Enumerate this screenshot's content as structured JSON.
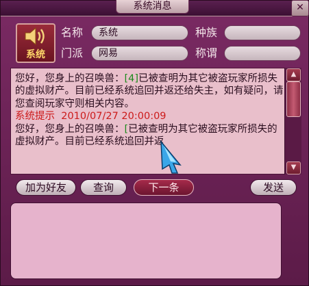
{
  "window": {
    "title": "系统消息",
    "close_icon": "close-icon"
  },
  "sender": {
    "icon": "speaker-icon",
    "label": "系统",
    "name_label": "名称",
    "name_value": "系统",
    "race_label": "种族",
    "race_value": "",
    "faction_label": "门派",
    "faction_value": "网易",
    "title_label": "称谓",
    "title_value": ""
  },
  "messages": [
    {
      "body_prefix": "您好，您身上的召唤兽：",
      "tag": "[4]",
      "body_suffix": "已被查明为其它被盗玩家所损失的虚拟财产。目前已经系统追回并返还给失主，如有疑问，请您查阅玩家守则相关内容。"
    },
    {
      "header_prefix": "系统提示",
      "timestamp": "2010/07/27 20:00:09",
      "body_prefix": "您好，您身上的召唤兽：",
      "tag": "[",
      "body_suffix": "已被查明为其它被盗玩家所损失的虚拟财产。目前已经系统追回并返"
    }
  ],
  "buttons": {
    "add_friend": "加为好友",
    "query": "查询",
    "next": "下一条",
    "send": "发送"
  },
  "input": {
    "value": ""
  },
  "colors": {
    "frame": "#5c1b48",
    "message_bg": "#e9bfcb",
    "input_bg": "#e6b3cc",
    "highlight_green": "#1c8a1c",
    "highlight_red": "#cc1a1a"
  }
}
